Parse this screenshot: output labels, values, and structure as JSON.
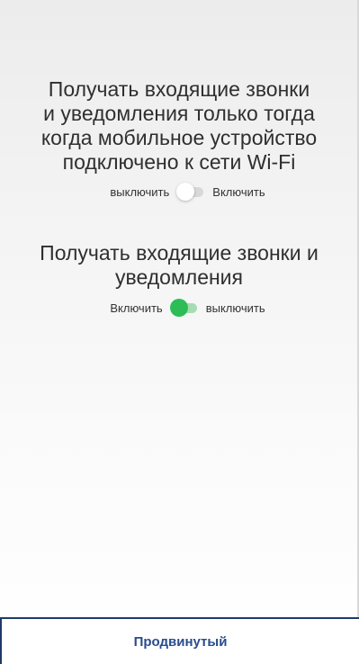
{
  "settings": {
    "wifi_only": {
      "title": "Получать входящие звонки\nи уведомления только тогда\nкогда мобильное устройство\nподключено к сети Wi-Fi",
      "label_left": "выключить",
      "label_right": "Включить",
      "state": "off"
    },
    "calls_notifications": {
      "title": "Получать входящие звонки и\nуведомления",
      "label_left": "Включить",
      "label_right": "выключить",
      "state": "on"
    }
  },
  "footer": {
    "advanced_label": "Продвинутый"
  },
  "colors": {
    "switch_on": "#2dbd57",
    "button_text": "#284c8c",
    "border": "#1f3a6b"
  }
}
